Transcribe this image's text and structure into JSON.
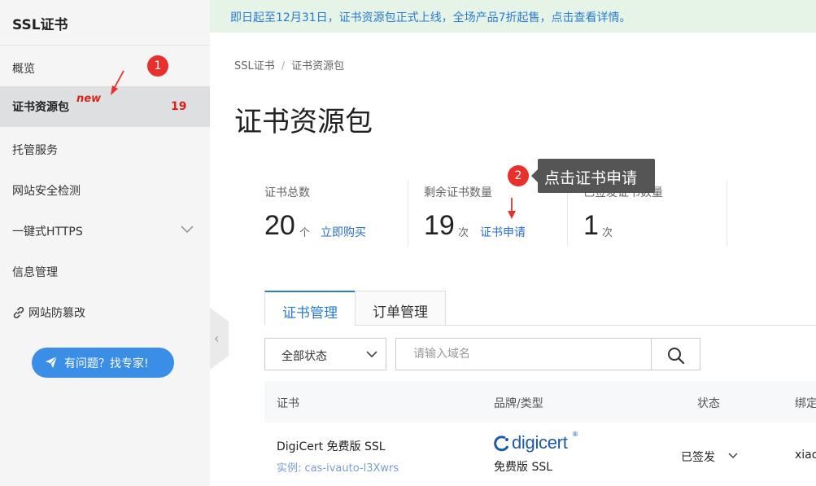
{
  "sidebar": {
    "title": "SSL证书",
    "items": [
      {
        "label": "概览"
      },
      {
        "label": "证书资源包",
        "tag": "new",
        "count": "19"
      },
      {
        "label": "托管服务"
      },
      {
        "label": "网站安全检测"
      },
      {
        "label": "一键式HTTPS"
      },
      {
        "label": "信息管理"
      },
      {
        "label": "网站防篡改"
      }
    ],
    "help_button": "有问题？找专家!"
  },
  "annotations": {
    "badge1": "1",
    "badge2": "2",
    "tooltip": "点击证书申请"
  },
  "banner": "即日起至12月31日，证书资源包正式上线，全场产品7折起售，点击查看详情。",
  "breadcrumb": [
    "SSL证书",
    "证书资源包"
  ],
  "page_title": "证书资源包",
  "stats": [
    {
      "label": "证书总数",
      "value": "20",
      "unit": "个",
      "link": "立即购买"
    },
    {
      "label": "剩余证书数量",
      "value": "19",
      "unit": "次",
      "link": "证书申请"
    },
    {
      "label": "已签发证书数量",
      "value": "1",
      "unit": "次"
    }
  ],
  "tabs": [
    {
      "label": "证书管理",
      "active": true
    },
    {
      "label": "订单管理",
      "active": false
    }
  ],
  "filters": {
    "status_value": "全部状态",
    "search_placeholder": "请输入域名"
  },
  "table": {
    "headers": [
      "证书",
      "品牌/类型",
      "状态",
      "绑定"
    ],
    "rows": [
      {
        "name": "DigiCert 免费版 SSL",
        "instance": "实例: cas-ivauto-l3Xwrs",
        "brand_logo": "digicert",
        "brand_mark": "®",
        "type": "免费版 SSL",
        "status": "已签发",
        "bind": "xiao"
      }
    ]
  },
  "colors": {
    "accent": "#2a7bd1",
    "red": "#e8302d",
    "banner_bg": "#e5f4e7",
    "brand": "#1d5aa8"
  }
}
